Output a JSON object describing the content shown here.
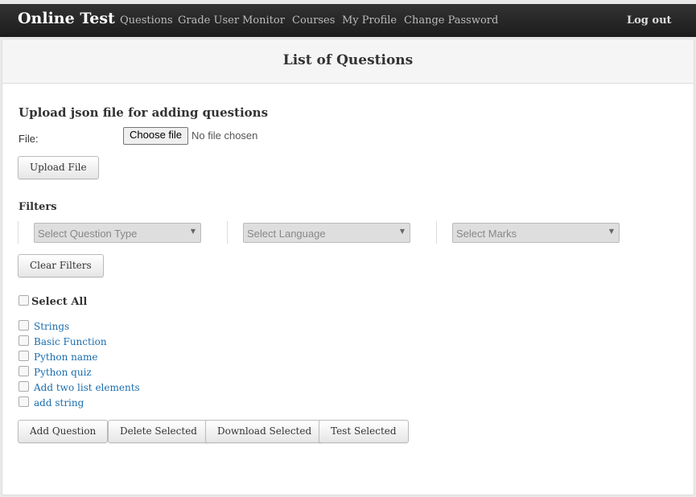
{
  "navbar": {
    "brand": "Online Test",
    "links": [
      "Questions",
      "Grade User",
      "Monitor",
      "Courses",
      "My Profile",
      "Change Password"
    ],
    "logout": "Log out"
  },
  "page": {
    "title": "List of Questions"
  },
  "upload": {
    "heading": "Upload json file for adding questions",
    "file_label": "File:",
    "choose_button": "Choose file",
    "no_file_text": "No file chosen",
    "upload_button": "Upload File"
  },
  "filters": {
    "heading": "Filters",
    "question_type_placeholder": "Select Question Type",
    "language_placeholder": "Select Language",
    "marks_placeholder": "Select Marks",
    "clear_button": "Clear Filters"
  },
  "questions": {
    "select_all_label": "Select All",
    "items": [
      "Strings",
      "Basic Function",
      "Python name",
      "Python quiz",
      "Add two list elements",
      "add string"
    ]
  },
  "actions": {
    "add": "Add Question",
    "delete": "Delete Selected",
    "download": "Download Selected",
    "test": "Test Selected"
  },
  "icons": {
    "dropdown": "chevron-down-icon",
    "checkbox": "checkbox-icon"
  },
  "colors": {
    "navbar_bg": "#222222",
    "link": "#1a6dad",
    "panel_head_bg": "#f5f5f5"
  }
}
